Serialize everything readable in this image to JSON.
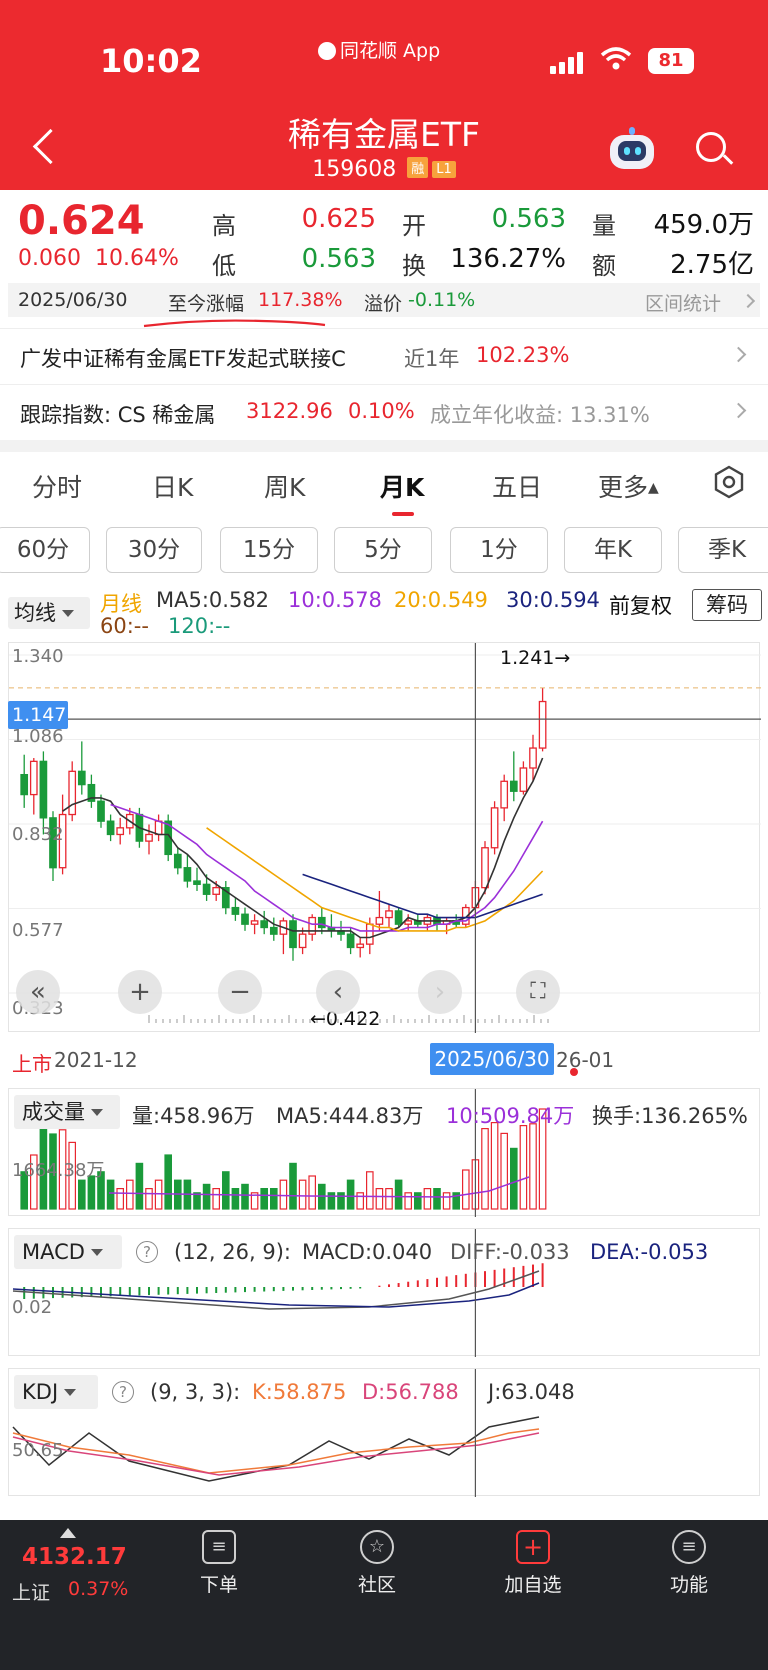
{
  "status_bar": {
    "time": "10:02",
    "app_label": "同花顺 App",
    "battery": "81"
  },
  "header": {
    "title": "稀有金属ETF",
    "code": "159608",
    "tags": [
      "融",
      "L1"
    ]
  },
  "quote": {
    "price": "0.624",
    "change_abs": "0.060",
    "change_pct": "10.64%",
    "high_label": "高",
    "high": "0.625",
    "low_label": "低",
    "low": "0.563",
    "open_label": "开",
    "open": "0.563",
    "turnover_label": "换",
    "turnover": "136.27%",
    "volume_label": "量",
    "volume": "459.0万",
    "amount_label": "额",
    "amount": "2.75亿"
  },
  "summary": {
    "date": "2025/06/30",
    "since_label": "至今涨幅",
    "since_value": "117.38%",
    "premium_label": "溢价",
    "premium_value": "-0.11%",
    "range_stats": "区间统计"
  },
  "linked_fund": {
    "name": "广发中证稀有金属ETF发起式联接C",
    "period": "近1年",
    "return": "102.23%"
  },
  "tracking": {
    "label": "跟踪指数: CS 稀金属",
    "value": "3122.96",
    "pct": "0.10%",
    "annualized": "成立年化收益: 13.31%"
  },
  "tabs": [
    "分时",
    "日K",
    "周K",
    "月K",
    "五日",
    "更多"
  ],
  "active_tab": "月K",
  "periods": [
    "60分",
    "30分",
    "15分",
    "5分",
    "1分",
    "年K",
    "季K"
  ],
  "ma_bar": {
    "selector": "均线",
    "type": "月线",
    "ma5": "MA5:0.582",
    "ma10": "10:0.578",
    "ma20": "20:0.549",
    "ma30": "30:0.594",
    "ma60": "60:--",
    "ma120": "120:--",
    "adjust": "前复权",
    "chip_button": "筹码"
  },
  "colors": {
    "up": "#e8262f",
    "down": "#1a9a3a",
    "ma5": "#333333",
    "ma10": "#9b30d9",
    "ma20": "#f0a500",
    "ma30": "#1a237e",
    "header": "#ec2a2f",
    "accent": "#3f8ff0"
  },
  "main_chart": {
    "y_ticks": [
      "1.340",
      "1.086",
      "0.832",
      "0.577",
      "0.323"
    ],
    "cursor_price": "1.147",
    "high_marker": "1.241→",
    "low_marker": "←0.422",
    "start_label": "上市",
    "start_date": "2021-12",
    "cursor_date": "2025/06/30",
    "end_date": "26-01"
  },
  "volume_panel": {
    "selector": "成交量",
    "vol": "量:458.96万",
    "ma5": "MA5:444.83万",
    "ma10": "10:509.84万",
    "turnover": "换手:136.265%",
    "y_tick": "1664.38万"
  },
  "macd_panel": {
    "selector": "MACD",
    "params": "(12, 26, 9):",
    "macd": "MACD:0.040",
    "diff": "DIFF:-0.033",
    "dea": "DEA:-0.053",
    "y_tick": "0.02"
  },
  "kdj_panel": {
    "selector": "KDJ",
    "params": "(9, 3, 3):",
    "k": "K:58.875",
    "d": "D:56.788",
    "j": "J:63.048",
    "y_tick": "50.65"
  },
  "bottom_nav": {
    "index_value": "4132.17",
    "index_name": "上证",
    "index_pct": "0.37%",
    "items": [
      "下单",
      "社区",
      "加自选",
      "功能"
    ]
  },
  "chart_data": {
    "type": "candlestick",
    "title": "",
    "x_range": [
      "2021-12",
      "2026-01"
    ],
    "ylim": [
      0.323,
      1.34
    ],
    "series": [
      {
        "name": "月K",
        "ohlc": [
          [
            0.98,
            1.04,
            0.88,
            0.92
          ],
          [
            0.92,
            1.03,
            0.86,
            1.02
          ],
          [
            1.02,
            1.05,
            0.8,
            0.85
          ],
          [
            0.85,
            0.87,
            0.66,
            0.7
          ],
          [
            0.7,
            0.92,
            0.68,
            0.86
          ],
          [
            0.86,
            1.02,
            0.84,
            0.99
          ],
          [
            0.99,
            1.08,
            0.92,
            0.95
          ],
          [
            0.95,
            0.98,
            0.88,
            0.9
          ],
          [
            0.9,
            0.92,
            0.82,
            0.84
          ],
          [
            0.84,
            0.86,
            0.78,
            0.8
          ],
          [
            0.8,
            0.85,
            0.77,
            0.82
          ],
          [
            0.82,
            0.88,
            0.8,
            0.86
          ],
          [
            0.86,
            0.88,
            0.76,
            0.78
          ],
          [
            0.78,
            0.83,
            0.74,
            0.8
          ],
          [
            0.8,
            0.86,
            0.78,
            0.84
          ],
          [
            0.84,
            0.86,
            0.72,
            0.74
          ],
          [
            0.74,
            0.76,
            0.68,
            0.7
          ],
          [
            0.7,
            0.74,
            0.64,
            0.66
          ],
          [
            0.66,
            0.7,
            0.63,
            0.65
          ],
          [
            0.65,
            0.68,
            0.6,
            0.62
          ],
          [
            0.62,
            0.66,
            0.6,
            0.64
          ],
          [
            0.64,
            0.66,
            0.56,
            0.58
          ],
          [
            0.58,
            0.61,
            0.54,
            0.56
          ],
          [
            0.56,
            0.58,
            0.51,
            0.53
          ],
          [
            0.53,
            0.56,
            0.5,
            0.54
          ],
          [
            0.54,
            0.57,
            0.5,
            0.52
          ],
          [
            0.52,
            0.55,
            0.48,
            0.5
          ],
          [
            0.5,
            0.55,
            0.44,
            0.54
          ],
          [
            0.54,
            0.56,
            0.42,
            0.46
          ],
          [
            0.46,
            0.52,
            0.44,
            0.5
          ],
          [
            0.5,
            0.56,
            0.48,
            0.55
          ],
          [
            0.55,
            0.58,
            0.5,
            0.52
          ],
          [
            0.52,
            0.56,
            0.49,
            0.51
          ],
          [
            0.51,
            0.54,
            0.48,
            0.5
          ],
          [
            0.5,
            0.52,
            0.44,
            0.46
          ],
          [
            0.46,
            0.49,
            0.43,
            0.47
          ],
          [
            0.47,
            0.55,
            0.44,
            0.53
          ],
          [
            0.53,
            0.63,
            0.51,
            0.55
          ],
          [
            0.55,
            0.59,
            0.52,
            0.57
          ],
          [
            0.57,
            0.58,
            0.52,
            0.53
          ],
          [
            0.53,
            0.56,
            0.51,
            0.54
          ],
          [
            0.54,
            0.56,
            0.52,
            0.53
          ],
          [
            0.53,
            0.56,
            0.51,
            0.55
          ],
          [
            0.55,
            0.56,
            0.51,
            0.53
          ],
          [
            0.53,
            0.55,
            0.5,
            0.54
          ],
          [
            0.54,
            0.56,
            0.52,
            0.53
          ],
          [
            0.53,
            0.59,
            0.52,
            0.58
          ],
          [
            0.58,
            0.66,
            0.56,
            0.64
          ],
          [
            0.64,
            0.78,
            0.62,
            0.76
          ],
          [
            0.76,
            0.9,
            0.74,
            0.88
          ],
          [
            0.88,
            0.98,
            0.84,
            0.96
          ],
          [
            0.96,
            1.05,
            0.9,
            0.93
          ],
          [
            0.93,
            1.02,
            0.92,
            1.0
          ],
          [
            1.0,
            1.1,
            0.96,
            1.06
          ],
          [
            1.06,
            1.24,
            1.05,
            1.2
          ]
        ]
      },
      {
        "name": "MA5",
        "values": [
          null,
          null,
          null,
          null,
          0.87,
          0.89,
          0.9,
          0.91,
          0.91,
          0.9,
          0.86,
          0.84,
          0.82,
          0.81,
          0.8,
          0.8,
          0.76,
          0.74,
          0.71,
          0.67,
          0.65,
          0.63,
          0.61,
          0.59,
          0.57,
          0.55,
          0.53,
          0.52,
          0.51,
          0.51,
          0.51,
          0.51,
          0.51,
          0.51,
          0.51,
          0.49,
          0.49,
          0.5,
          0.51,
          0.52,
          0.55,
          0.54,
          0.54,
          0.54,
          0.54,
          0.54,
          0.55,
          0.58,
          0.63,
          0.7,
          0.78,
          0.85,
          0.91,
          0.96,
          1.03
        ]
      },
      {
        "name": "MA10",
        "values": [
          null,
          null,
          null,
          null,
          null,
          null,
          null,
          null,
          null,
          0.89,
          0.88,
          0.87,
          0.86,
          0.85,
          0.84,
          0.83,
          0.81,
          0.79,
          0.77,
          0.74,
          0.72,
          0.7,
          0.68,
          0.66,
          0.63,
          0.61,
          0.59,
          0.57,
          0.55,
          0.54,
          0.53,
          0.53,
          0.52,
          0.52,
          0.52,
          0.51,
          0.51,
          0.51,
          0.51,
          0.51,
          0.52,
          0.52,
          0.52,
          0.53,
          0.53,
          0.54,
          0.54,
          0.56,
          0.58,
          0.61,
          0.65,
          0.69,
          0.74,
          0.79,
          0.84
        ]
      },
      {
        "name": "MA20",
        "values": [
          null,
          null,
          null,
          null,
          null,
          null,
          null,
          null,
          null,
          null,
          null,
          null,
          null,
          null,
          null,
          null,
          null,
          null,
          null,
          0.82,
          0.8,
          0.78,
          0.76,
          0.74,
          0.72,
          0.7,
          0.68,
          0.66,
          0.64,
          0.62,
          0.6,
          0.58,
          0.57,
          0.56,
          0.55,
          0.54,
          0.53,
          0.52,
          0.52,
          0.51,
          0.51,
          0.51,
          0.51,
          0.51,
          0.51,
          0.52,
          0.52,
          0.53,
          0.54,
          0.56,
          0.58,
          0.6,
          0.63,
          0.66,
          0.69
        ]
      },
      {
        "name": "MA30",
        "values": [
          null,
          null,
          null,
          null,
          null,
          null,
          null,
          null,
          null,
          null,
          null,
          null,
          null,
          null,
          null,
          null,
          null,
          null,
          null,
          null,
          null,
          null,
          null,
          null,
          null,
          null,
          null,
          null,
          null,
          0.68,
          0.67,
          0.66,
          0.65,
          0.64,
          0.63,
          0.62,
          0.61,
          0.6,
          0.59,
          0.58,
          0.57,
          0.56,
          0.56,
          0.55,
          0.55,
          0.55,
          0.55,
          0.55,
          0.56,
          0.57,
          0.58,
          0.59,
          0.6,
          0.61,
          0.62
        ]
      }
    ]
  }
}
